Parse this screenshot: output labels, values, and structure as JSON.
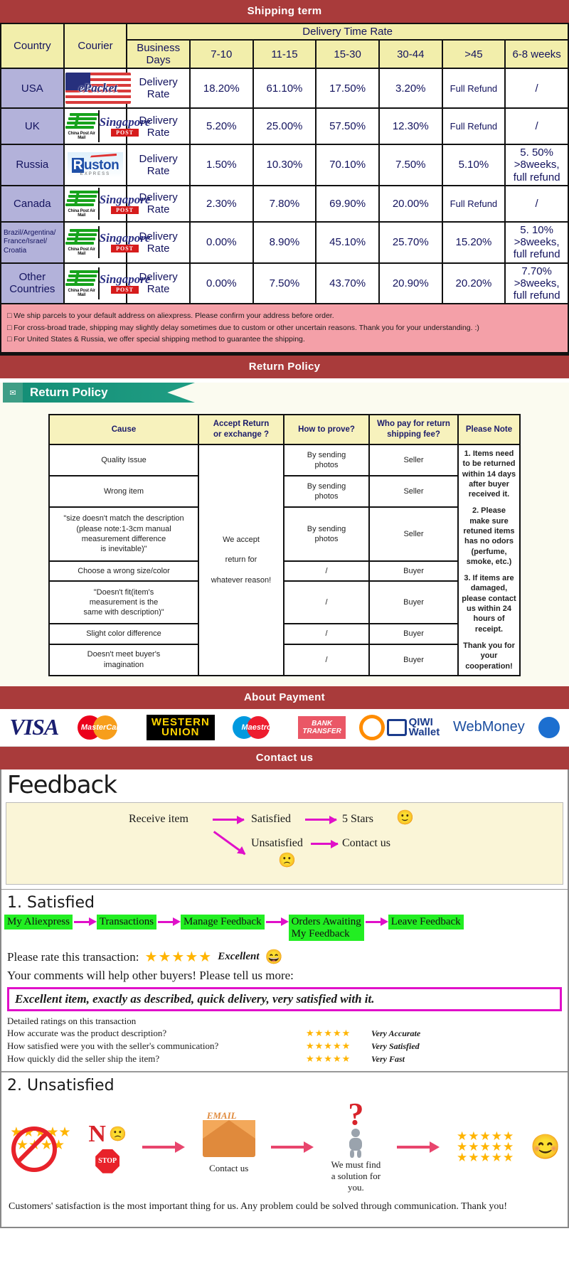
{
  "banners": {
    "shipping": "Shipping term",
    "return": "Return Policy",
    "payment": "About Payment",
    "contact": "Contact us"
  },
  "shipping_table": {
    "headers": {
      "country": "Country",
      "courier": "Courier",
      "delivery_time_rate": "Delivery Time Rate",
      "business_days": "Business Days",
      "ranges": [
        "7-10",
        "11-15",
        "15-30",
        "30-44",
        ">45",
        "6-8 weeks"
      ]
    },
    "rows": [
      {
        "country": "USA",
        "country_small": false,
        "couriers": [
          "epacket"
        ],
        "label": "Delivery Rate",
        "values": [
          "18.20%",
          "61.10%",
          "17.50%",
          "3.20%",
          "Full Refund",
          "/"
        ],
        "last_multiline": false
      },
      {
        "country": "UK",
        "country_small": false,
        "couriers": [
          "china-post",
          "singapore-post"
        ],
        "label": "Delivery Rate",
        "values": [
          "5.20%",
          "25.00%",
          "57.50%",
          "12.30%",
          "Full Refund",
          "/"
        ],
        "last_multiline": false
      },
      {
        "country": "Russia",
        "country_small": false,
        "couriers": [
          "ruston"
        ],
        "label": "Delivery Rate",
        "values": [
          "1.50%",
          "10.30%",
          "70.10%",
          "7.50%",
          "5.10%",
          "5. 50%\n>8weeks,\nfull refund"
        ],
        "last_multiline": true
      },
      {
        "country": "Canada",
        "country_small": false,
        "couriers": [
          "china-post",
          "singapore-post"
        ],
        "label": "Delivery Rate",
        "values": [
          "2.30%",
          "7.80%",
          "69.90%",
          "20.00%",
          "Full Refund",
          "/"
        ],
        "last_multiline": false
      },
      {
        "country": "Brazil/Argentina/\nFrance/Israel/\nCroatia",
        "country_small": true,
        "couriers": [
          "china-post",
          "singapore-post"
        ],
        "label": "Delivery Rate",
        "values": [
          "0.00%",
          "8.90%",
          "45.10%",
          "25.70%",
          "15.20%",
          "5. 10%\n>8weeks,\nfull refund"
        ],
        "last_multiline": true
      },
      {
        "country": "Other Countries",
        "country_small": false,
        "couriers": [
          "china-post",
          "singapore-post"
        ],
        "label": "Delivery Rate",
        "values": [
          "0.00%",
          "7.50%",
          "43.70%",
          "20.90%",
          "20.20%",
          "7.70%\n>8weeks,\nfull refund"
        ],
        "last_multiline": true
      }
    ],
    "notes": [
      "We ship parcels to your default address on aliexpress. Please confirm your address before order.",
      "For cross-broad trade, shipping may slightly delay sometimes due to custom or other uncertain reasons. Thank you for your understanding. :)",
      "For United States & Russia, we offer special shipping method to guarantee the shipping."
    ]
  },
  "return_policy": {
    "tag_label": "Return Policy",
    "headers": [
      "Cause",
      "Accept Return\nor exchange ?",
      "How to prove?",
      "Who pay for return\nshipping fee?",
      "Please Note"
    ],
    "accept_text": "We accept\n\nreturn for\n\nwhatever reason!",
    "rows": [
      {
        "cause": "Quality Issue",
        "prove": "By sending\nphotos",
        "payer": "Seller"
      },
      {
        "cause": "Wrong item",
        "prove": "By sending\nphotos",
        "payer": "Seller"
      },
      {
        "cause": "\"size doesn't match the description\n(please note:1-3cm manual\nmeasurement difference\nis inevitable)\"",
        "prove": "By sending\nphotos",
        "payer": "Seller"
      },
      {
        "cause": "Choose a wrong size/color",
        "prove": "/",
        "payer": "Buyer"
      },
      {
        "cause": "\"Doesn't fit(item's\nmeasurement is the\nsame with description)\"",
        "prove": "/",
        "payer": "Buyer"
      },
      {
        "cause": "Slight color difference",
        "prove": "/",
        "payer": "Buyer"
      },
      {
        "cause": "Doesn't meet buyer's\nimagination",
        "prove": "/",
        "payer": "Buyer"
      }
    ],
    "notes": [
      "1. Items need to be returned within 14 days after buyer received it.",
      "2. Please make sure retuned items has no odors (perfume, smoke, etc.)",
      "3. If items are damaged, please contact us within 24 hours of receipt.",
      "Thank you for your cooperation!"
    ]
  },
  "payment": {
    "methods": [
      {
        "name": "visa",
        "label": "VISA"
      },
      {
        "name": "mastercard",
        "label": "MasterCard"
      },
      {
        "name": "western-union",
        "label_top": "WESTERN",
        "label_bottom": "UNION"
      },
      {
        "name": "maestro",
        "label": "Maestro"
      },
      {
        "name": "bank-transfer",
        "label_top": "BANK",
        "label_bottom": "TRANSFER"
      },
      {
        "name": "qiwi-wallet",
        "label_top": "QIWI",
        "label_bottom": "Wallet"
      },
      {
        "name": "webmoney",
        "label": "WebMoney"
      }
    ]
  },
  "feedback": {
    "title": "Feedback",
    "flow": {
      "receive": "Receive item",
      "satisfied": "Satisfied",
      "five_stars": "5 Stars",
      "unsatisfied": "Unsatisfied",
      "contact": "Contact us",
      "happy_emoji": "🙂",
      "sad_emoji": "🙁"
    },
    "satisfied": {
      "heading": "1. Satisfied",
      "steps": [
        "My Aliexpress",
        "Transactions",
        "Manage Feedback",
        "Orders Awaiting\nMy Feedback",
        "Leave Feedback"
      ],
      "rate_label": "Please rate this transaction:",
      "stars": "★★★★★",
      "rate_word": "Excellent",
      "rate_emoji": "😄",
      "comments_label": "Your comments will help other buyers! Please tell us more:",
      "comment_text": "Excellent item, exactly as described, quick delivery, very satisfied with it.",
      "detail_head": "Detailed ratings on this transaction",
      "details": [
        {
          "question": "How accurate was the product description?",
          "stars": "★★★★★",
          "value": "Very Accurate"
        },
        {
          "question": "How satisfied were you with the seller's communication?",
          "stars": "★★★★★",
          "value": "Very Satisfied"
        },
        {
          "question": "How quickly did the seller ship the item?",
          "stars": "★★★★★",
          "value": "Very Fast"
        }
      ]
    },
    "unsatisfied": {
      "heading": "2. Unsatisfied",
      "no_letter": "N",
      "stop_label": "STOP",
      "email_label": "EMAIL",
      "contact_label": "Contact us",
      "solution_label": "We must find\na solution for\nyou.",
      "smiley": "😊",
      "footer": "Customers' satisfaction is the most important thing for us. Any problem could be solved through communication. Thank you!"
    }
  }
}
